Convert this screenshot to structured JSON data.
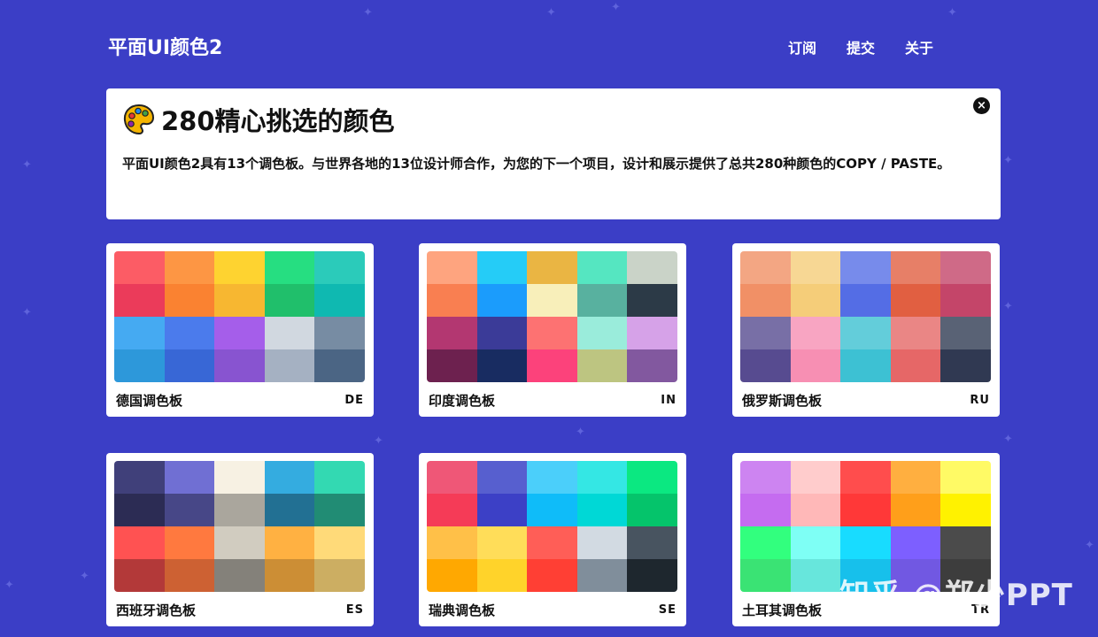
{
  "header": {
    "brand": "平面UI颜色2",
    "nav": [
      {
        "label": "订阅"
      },
      {
        "label": "提交"
      },
      {
        "label": "关于"
      }
    ]
  },
  "banner": {
    "title": "280精心挑选的颜色",
    "description": "平面UI颜色2具有13个调色板。与世界各地的13位设计师合作，为您的下一个项目，设计和展示提供了总共280种颜色的COPY / PASTE。",
    "close_icon": "×"
  },
  "palettes": [
    {
      "name": "德国调色板",
      "code": "DE",
      "colors": [
        "#fc5c65",
        "#fd9644",
        "#fed330",
        "#26de81",
        "#2bcbba",
        "#eb3b5a",
        "#fa8231",
        "#f7b731",
        "#20bf6b",
        "#0fb9b1",
        "#45aaf2",
        "#4b7bec",
        "#a55eea",
        "#d1d8e0",
        "#778ca3",
        "#2d98da",
        "#3867d6",
        "#8854d0",
        "#a5b1c2",
        "#4b6584"
      ]
    },
    {
      "name": "印度调色板",
      "code": "IN",
      "colors": [
        "#fea47f",
        "#25ccf7",
        "#eab543",
        "#55e6c1",
        "#cad3c8",
        "#f97f51",
        "#1b9cfc",
        "#f8efba",
        "#58b19f",
        "#2c3a47",
        "#b33771",
        "#3b3b98",
        "#fd7272",
        "#9aecdb",
        "#d6a2e8",
        "#6d214f",
        "#182c61",
        "#fc427b",
        "#bdc581",
        "#82589f"
      ]
    },
    {
      "name": "俄罗斯调色板",
      "code": "RU",
      "colors": [
        "#f3a683",
        "#f7d794",
        "#778beb",
        "#e77f67",
        "#cf6a87",
        "#f19066",
        "#f5cd79",
        "#546de5",
        "#e15f41",
        "#c44569",
        "#786fa6",
        "#f8a5c2",
        "#63cdda",
        "#ea8685",
        "#596275",
        "#574b90",
        "#f78fb3",
        "#3dc1d3",
        "#e66767",
        "#303952"
      ]
    },
    {
      "name": "西班牙调色板",
      "code": "ES",
      "colors": [
        "#40407a",
        "#706fd3",
        "#f7f1e3",
        "#34ace0",
        "#33d9b2",
        "#2c2c54",
        "#474787",
        "#aaa69d",
        "#227093",
        "#218c74",
        "#ff5252",
        "#ff793f",
        "#d1ccc0",
        "#ffb142",
        "#ffda79",
        "#b33939",
        "#cd6133",
        "#84817a",
        "#cc8e35",
        "#ccae62"
      ]
    },
    {
      "name": "瑞典调色板",
      "code": "SE",
      "colors": [
        "#ef5777",
        "#575fcf",
        "#4bcffa",
        "#34e7e4",
        "#0be881",
        "#f53b57",
        "#3c40c6",
        "#0fbcf9",
        "#00d8d6",
        "#05c46b",
        "#ffc048",
        "#ffdd59",
        "#ff5e57",
        "#d2dae2",
        "#485460",
        "#ffa801",
        "#ffd32a",
        "#ff3f34",
        "#808e9b",
        "#1e272e"
      ]
    },
    {
      "name": "土耳其调色板",
      "code": "TR",
      "colors": [
        "#cd84f1",
        "#ffcccc",
        "#ff4d4d",
        "#ffaf40",
        "#fffa65",
        "#c56cf0",
        "#ffb8b8",
        "#ff3838",
        "#ff9f1a",
        "#fff200",
        "#32ff7e",
        "#7efff5",
        "#18dcff",
        "#7d5fff",
        "#4b4b4b",
        "#3ae374",
        "#67e6dc",
        "#17c0eb",
        "#7158e2",
        "#3d3d3d"
      ]
    }
  ],
  "watermark": "知乎 @郑少PPT"
}
